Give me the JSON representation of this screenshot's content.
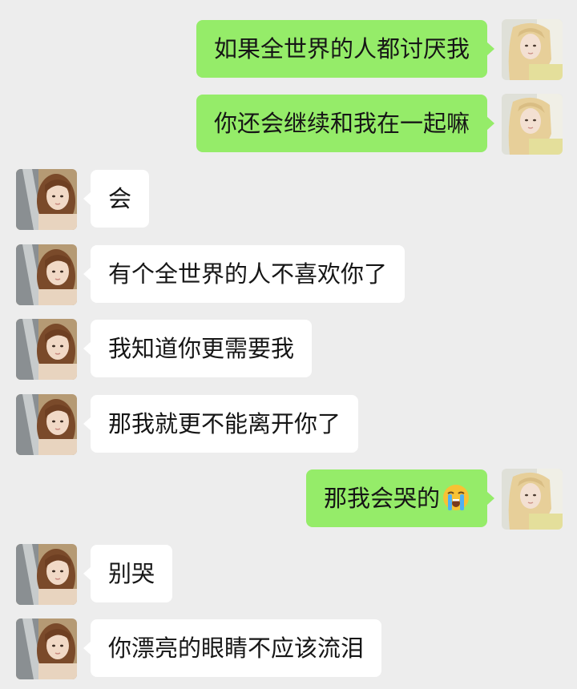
{
  "colors": {
    "background": "#ededed",
    "sent_bubble": "#95ec69",
    "received_bubble": "#ffffff",
    "text": "#161616"
  },
  "messages": [
    {
      "side": "right",
      "text": "如果全世界的人都讨厌我",
      "avatar": "blonde-girl-avatar"
    },
    {
      "side": "right",
      "text": "你还会继续和我在一起嘛",
      "avatar": "blonde-girl-avatar"
    },
    {
      "side": "left",
      "text": "会",
      "avatar": "long-hair-girl-avatar"
    },
    {
      "side": "left",
      "text": "有个全世界的人不喜欢你了",
      "avatar": "long-hair-girl-avatar"
    },
    {
      "side": "left",
      "text": "我知道你更需要我",
      "avatar": "long-hair-girl-avatar"
    },
    {
      "side": "left",
      "text": "那我就更不能离开你了",
      "avatar": "long-hair-girl-avatar"
    },
    {
      "side": "right",
      "text": "那我会哭的",
      "emoji": "loudly-crying-face-emoji",
      "avatar": "blonde-girl-avatar"
    },
    {
      "side": "left",
      "text": "别哭",
      "avatar": "long-hair-girl-avatar"
    },
    {
      "side": "left",
      "text": "你漂亮的眼睛不应该流泪",
      "avatar": "long-hair-girl-avatar"
    }
  ]
}
